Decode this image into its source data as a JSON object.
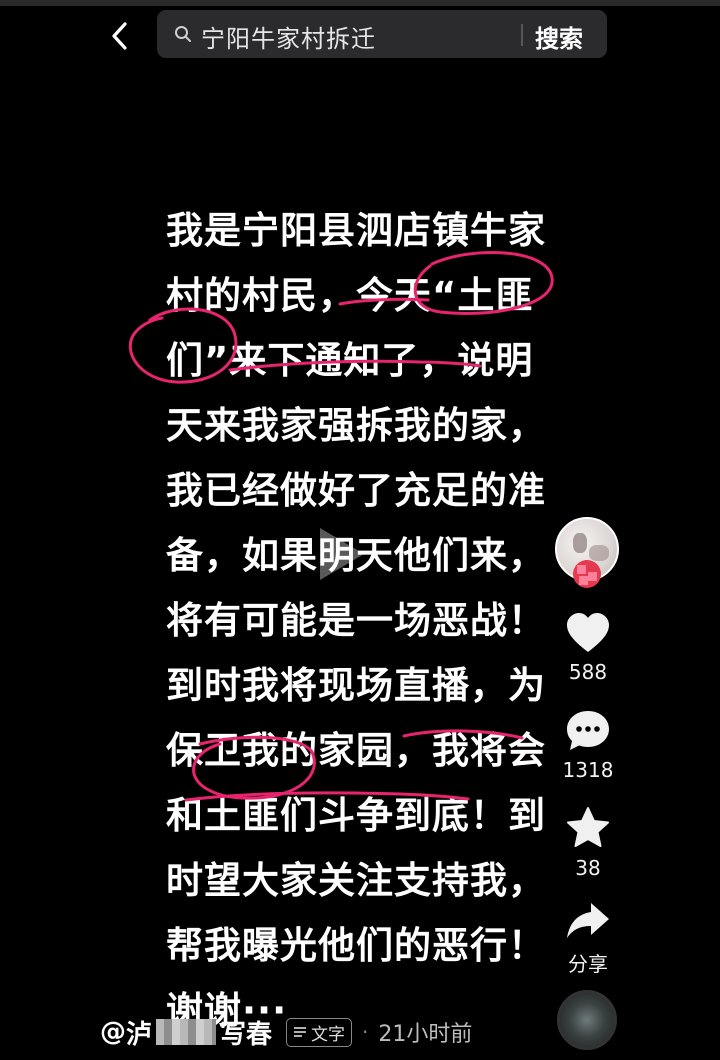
{
  "search": {
    "query": "宁阳牛家村拆迁",
    "button_label": "搜索"
  },
  "post": {
    "lines": [
      "我是宁阳县泗店镇牛家",
      "村的村民，今天“土匪",
      "们”来下通知了，说明",
      "天来我家强拆我的家，",
      "我已经做好了充足的准",
      "备，如果明天他们来，",
      "将有可能是一场恶战！",
      "到时我将现场直播，为",
      "保卫我的家园，我将会",
      "和土匪们斗争到底！到",
      "时望大家关注支持我，",
      "帮我曝光他们的恶行！",
      "谢谢···"
    ],
    "annotation_color": "#e8246e"
  },
  "rail": {
    "likes": "588",
    "comments": "1318",
    "favorites": "38",
    "share_label": "分享"
  },
  "footer": {
    "author_prefix": "@",
    "author_first": "泸",
    "author_last": "写春",
    "text_tag": "文字",
    "separator": "·",
    "time": "21小时前"
  }
}
